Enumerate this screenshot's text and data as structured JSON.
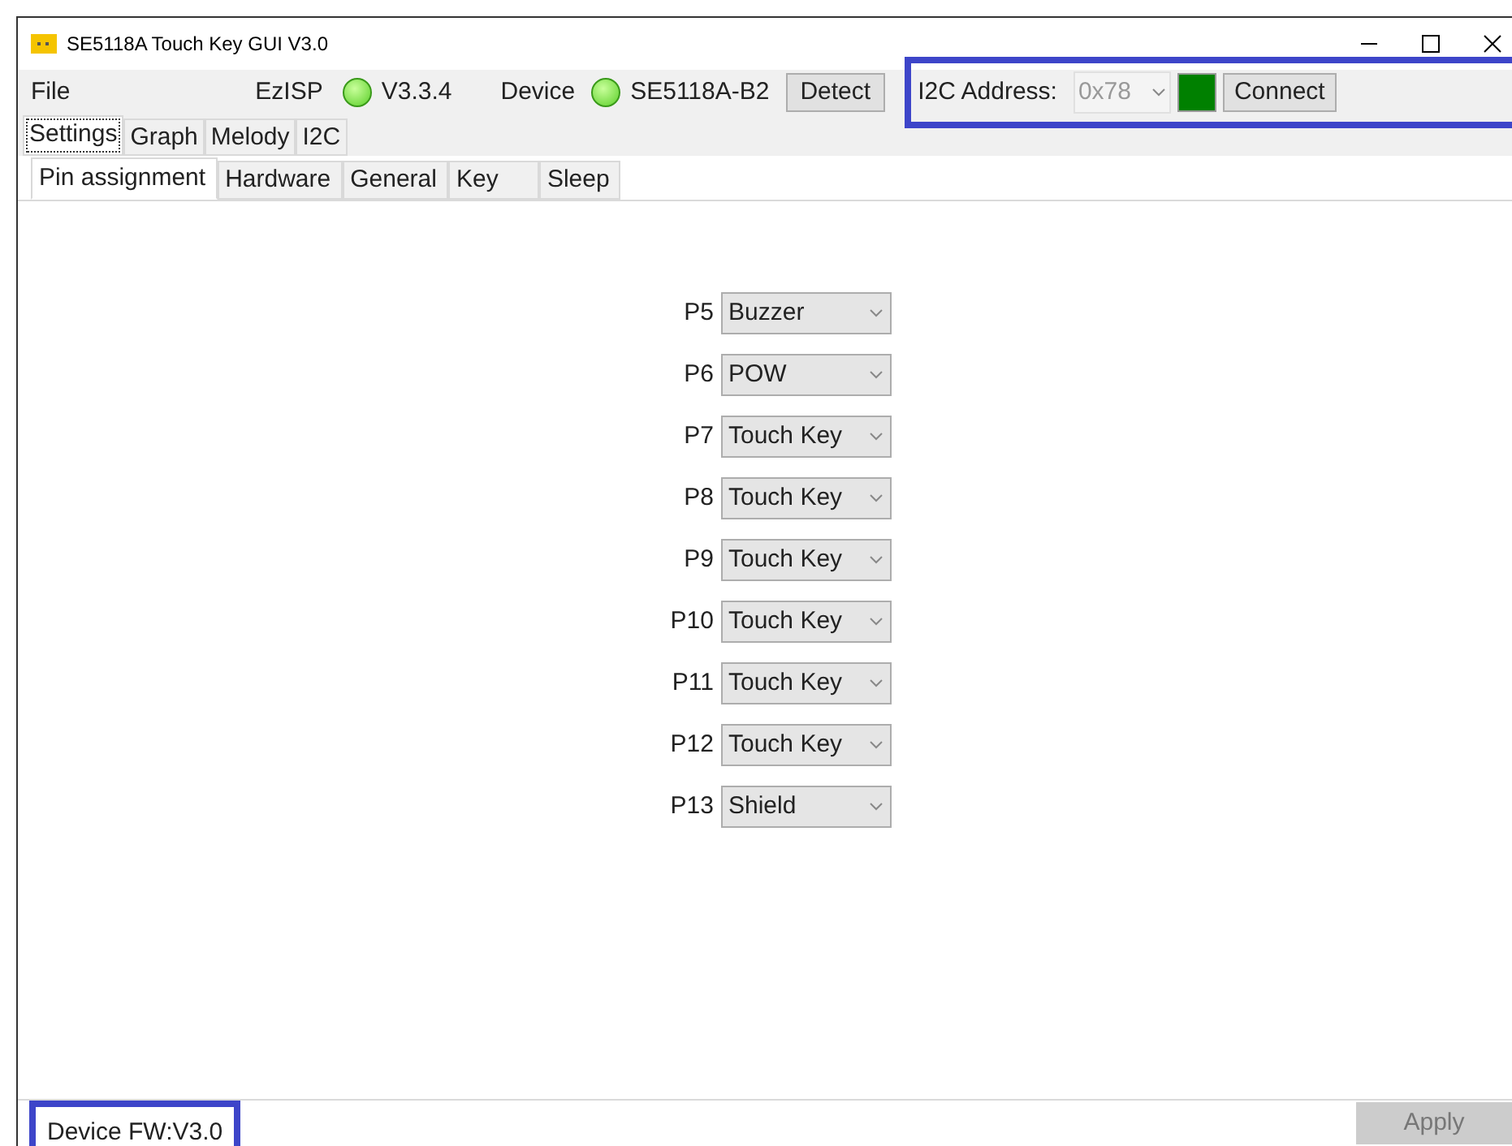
{
  "window": {
    "title": "SE5118A Touch Key GUI V3.0"
  },
  "menu": {
    "items": [
      "File"
    ]
  },
  "ezisp": {
    "label": "EzISP",
    "ok": true,
    "version": "V3.3.4"
  },
  "device": {
    "label": "Device",
    "ok": true,
    "name": "SE5118A-B2",
    "button": "Detect"
  },
  "i2c": {
    "label": "I2C Address:",
    "value": "0x78",
    "disabled": true,
    "connected": true,
    "button": "Connect"
  },
  "tabs": [
    {
      "label": "Settings",
      "selected": true
    },
    {
      "label": "Graph",
      "selected": false
    },
    {
      "label": "Melody",
      "selected": false
    },
    {
      "label": "I2C",
      "selected": false
    }
  ],
  "subtabs": [
    {
      "label": "Pin assignment",
      "selected": true
    },
    {
      "label": "Hardware",
      "selected": false
    },
    {
      "label": "General",
      "selected": false
    },
    {
      "label": "Key",
      "selected": false
    },
    {
      "label": "Sleep",
      "selected": false
    }
  ],
  "pins": [
    {
      "name": "P5",
      "value": "Buzzer"
    },
    {
      "name": "P6",
      "value": "POW"
    },
    {
      "name": "P7",
      "value": "Touch Key"
    },
    {
      "name": "P8",
      "value": "Touch Key"
    },
    {
      "name": "P9",
      "value": "Touch Key"
    },
    {
      "name": "P10",
      "value": "Touch Key"
    },
    {
      "name": "P11",
      "value": "Touch Key"
    },
    {
      "name": "P12",
      "value": "Touch Key"
    },
    {
      "name": "P13",
      "value": "Shield"
    }
  ],
  "status_bar": {
    "firmware": "Device FW:V3.0",
    "apply": {
      "label": "Apply",
      "disabled": true
    }
  }
}
